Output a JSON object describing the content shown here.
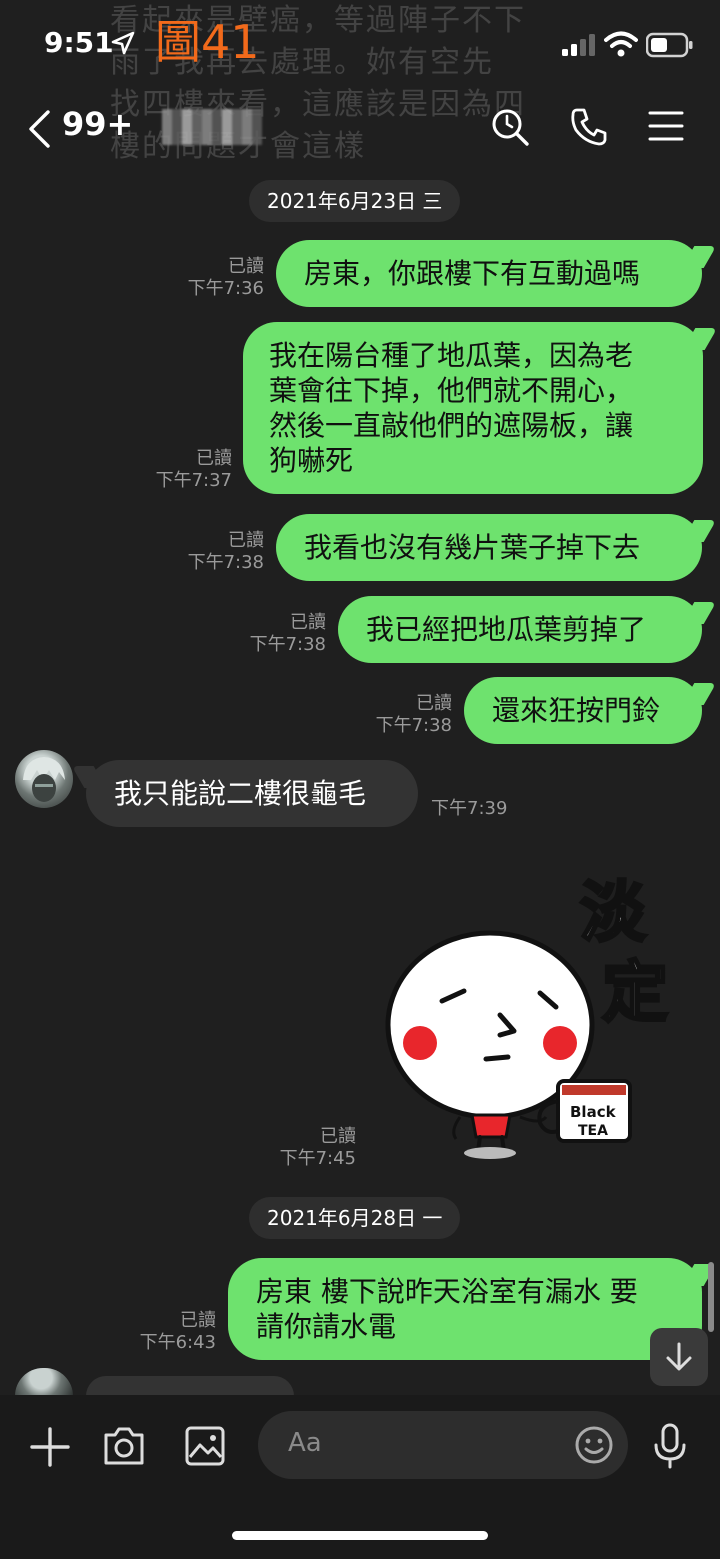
{
  "status_bar": {
    "time": "9:51",
    "figure_label": "圖41"
  },
  "background_overlay_text": "看起來是壁癌，等過陣子不下\n雨了我再去處理。妳有空先\n找四樓來看，這應該是因為四\n樓的問題才會這樣",
  "header": {
    "unread_count": "99+"
  },
  "colors": {
    "outgoing_bubble": "#6ee26e",
    "incoming_bubble": "#333333",
    "figure_label": "#f26a1b",
    "background": "#1f1f1f"
  },
  "chat": {
    "date_1": "2021年6月23日 三",
    "date_2": "2021年6月28日 一",
    "read_label": "已讀",
    "messages": [
      {
        "direction": "out",
        "text": "房東，你跟樓下有互動過嗎",
        "time": "下午7:36"
      },
      {
        "direction": "out",
        "text": "我在陽台種了地瓜葉，因為老\n葉會往下掉，他們就不開心，\n然後一直敲他們的遮陽板，讓\n狗嚇死",
        "time": "下午7:37"
      },
      {
        "direction": "out",
        "text": "我看也沒有幾片葉子掉下去",
        "time": "下午7:38"
      },
      {
        "direction": "out",
        "text": "我已經把地瓜葉剪掉了",
        "time": "下午7:38"
      },
      {
        "direction": "out",
        "text": "還來狂按門鈴",
        "time": "下午7:38"
      },
      {
        "direction": "in",
        "text": "我只能說二樓很龜毛",
        "time": "下午7:39"
      },
      {
        "direction": "out",
        "sticker": "sticker-tea",
        "time": "下午7:45"
      },
      {
        "direction": "out",
        "text": "房東 樓下說昨天浴室有漏水 要\n請你請水電",
        "time": "下午6:43"
      }
    ],
    "sticker": {
      "text_1": "淡",
      "text_2": "定",
      "cup_text_1": "Black",
      "cup_text_2": "TEA"
    }
  },
  "input_bar": {
    "placeholder": "Aa"
  }
}
